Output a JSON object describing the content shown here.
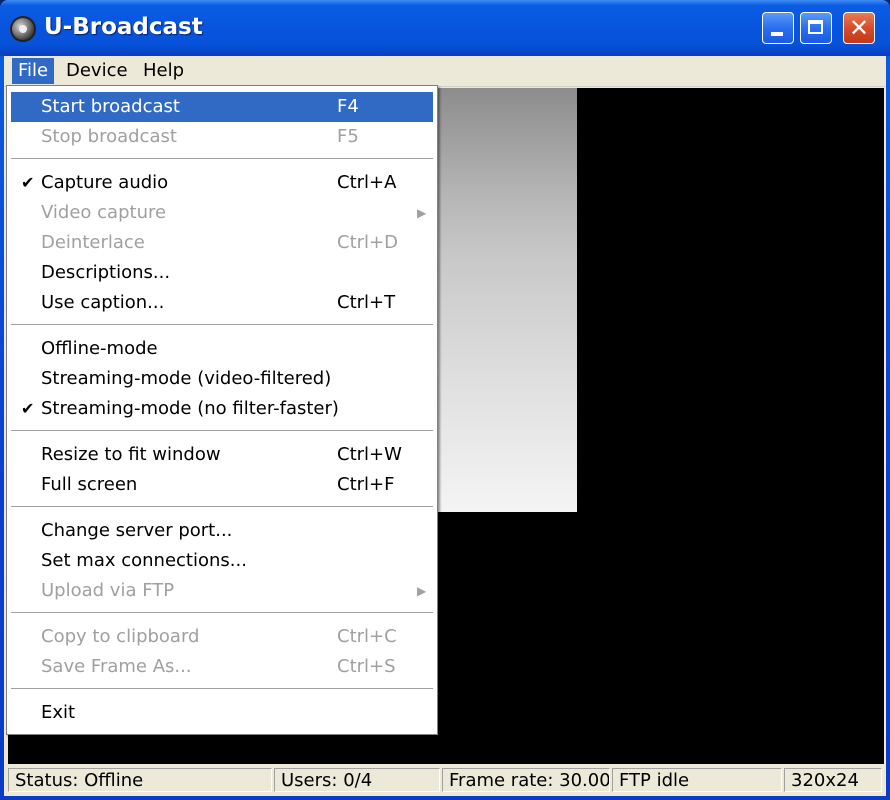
{
  "window": {
    "title": "U-Broadcast"
  },
  "menubar": {
    "file": "File",
    "device": "Device",
    "help": "Help"
  },
  "file_menu": {
    "items": [
      {
        "label": "Start broadcast",
        "shortcut": "F4"
      },
      {
        "label": "Stop broadcast",
        "shortcut": "F5"
      },
      {
        "label": "Capture audio",
        "shortcut": "Ctrl+A"
      },
      {
        "label": "Video capture",
        "shortcut": ""
      },
      {
        "label": "Deinterlace",
        "shortcut": "Ctrl+D"
      },
      {
        "label": "Descriptions...",
        "shortcut": ""
      },
      {
        "label": "Use caption...",
        "shortcut": "Ctrl+T"
      },
      {
        "label": "Offline-mode",
        "shortcut": ""
      },
      {
        "label": "Streaming-mode (video-filtered)",
        "shortcut": ""
      },
      {
        "label": "Streaming-mode (no filter-faster)",
        "shortcut": ""
      },
      {
        "label": "Resize to fit window",
        "shortcut": "Ctrl+W"
      },
      {
        "label": "Full screen",
        "shortcut": "Ctrl+F"
      },
      {
        "label": "Change server port...",
        "shortcut": ""
      },
      {
        "label": "Set max connections...",
        "shortcut": ""
      },
      {
        "label": "Upload via FTP",
        "shortcut": ""
      },
      {
        "label": "Copy to clipboard",
        "shortcut": "Ctrl+C"
      },
      {
        "label": "Save Frame As...",
        "shortcut": "Ctrl+S"
      },
      {
        "label": "Exit",
        "shortcut": ""
      }
    ]
  },
  "statusbar": {
    "status": "Status: Offline",
    "users": "Users: 0/4",
    "frame_rate": "Frame rate: 30.00",
    "ftp": "FTP idle",
    "resolution": "320x24"
  },
  "icons": {
    "check": "✔",
    "submenu": "▶",
    "close": "✕"
  },
  "colors": {
    "highlight": "#316ac5",
    "disabled": "#a0a0a0",
    "titlebar": "#0854de"
  }
}
